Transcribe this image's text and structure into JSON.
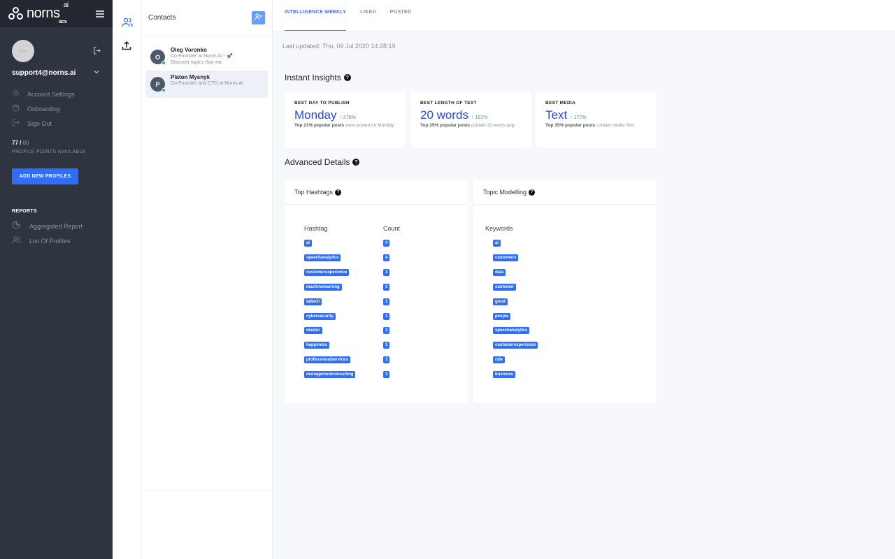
{
  "brand": {
    "name": "norns",
    "suffix": "ai",
    "badge": "BETA"
  },
  "sidebar": {
    "avatar_text": "60 x 60",
    "email": "support4@norns.ai",
    "menu": [
      {
        "label": "Account Settings",
        "icon": "gear-icon"
      },
      {
        "label": "Onboarding",
        "icon": "help-circle-icon"
      },
      {
        "label": "Sign Out",
        "icon": "sign-out-icon"
      }
    ],
    "points_used": "77",
    "points_sep": " / ",
    "points_total": "80",
    "points_label": "PROFILE POINTS AVAILABLE",
    "add_button": "ADD NEW PROFILES",
    "reports_heading": "REPORTS",
    "reports": [
      {
        "label": "Aggregated Report",
        "icon": "pie-chart-icon"
      },
      {
        "label": "List Of Profiles",
        "icon": "users-icon"
      }
    ]
  },
  "contacts": {
    "title": "Contacts",
    "items": [
      {
        "initial": "O",
        "name": "Oleg Voronko",
        "line1": "Co-Founder at Norns AI - 🚀",
        "line2": "Discover topics that ma",
        "online": true,
        "selected": false
      },
      {
        "initial": "P",
        "name": "Platon Mysnyk",
        "line1": "Co-Founder and CTO at Norns AI",
        "line2": "",
        "online": true,
        "selected": true
      }
    ]
  },
  "main": {
    "tabs": [
      {
        "label": "INTELLIGENCE WEEKLY",
        "active": true
      },
      {
        "label": "LIKED",
        "active": false
      },
      {
        "label": "POSTED",
        "active": false
      }
    ],
    "last_updated": "Last updated: Thu, 09 Jul 2020 14:28:19",
    "instant_insights_title": "Instant Insights",
    "insights": [
      {
        "label": "BEST DAY TO PUBLISH",
        "value": "Monday",
        "change": "↑ 278%",
        "desc_bold": "Top 21% popular posts",
        "desc": " were posted on Monday"
      },
      {
        "label": "BEST LENGTH OF TEXT",
        "value": "20 words",
        "change": "↑ 181%",
        "desc_bold": "Top 35% popular posts",
        "desc": " contain 20 words avg."
      },
      {
        "label": "BEST MEDIA",
        "value": "Text",
        "change": "↑ 177%",
        "desc_bold": "Top 35% popular posts",
        "desc": " contain media Text"
      }
    ],
    "advanced_title": "Advanced Details",
    "hashtags": {
      "title": "Top Hashtags",
      "col_hashtag": "Hashtag",
      "col_count": "Count",
      "rows": [
        {
          "tag": "ai",
          "count": "4"
        },
        {
          "tag": "speechanalytics",
          "count": "4"
        },
        {
          "tag": "customerexperience",
          "count": "3"
        },
        {
          "tag": "machinelearning",
          "count": "3"
        },
        {
          "tag": "taltech",
          "count": "1"
        },
        {
          "tag": "cybersecurity",
          "count": "1"
        },
        {
          "tag": "master",
          "count": "1"
        },
        {
          "tag": "happiness",
          "count": "1"
        },
        {
          "tag": "professionalservices",
          "count": "1"
        },
        {
          "tag": "managementconsulting",
          "count": "1"
        }
      ]
    },
    "topics": {
      "title": "Topic Modelling",
      "col_keywords": "Keywords",
      "keywords": [
        "ai",
        "customers",
        "data",
        "customer",
        "good",
        "people",
        "speechanalytics",
        "customerexperience",
        "rule",
        "business"
      ]
    }
  },
  "colors": {
    "accent": "#2f6ef8",
    "value_blue": "#2748f0",
    "positive": "#3bb14a",
    "sidebar_bg": "#2e3440"
  }
}
